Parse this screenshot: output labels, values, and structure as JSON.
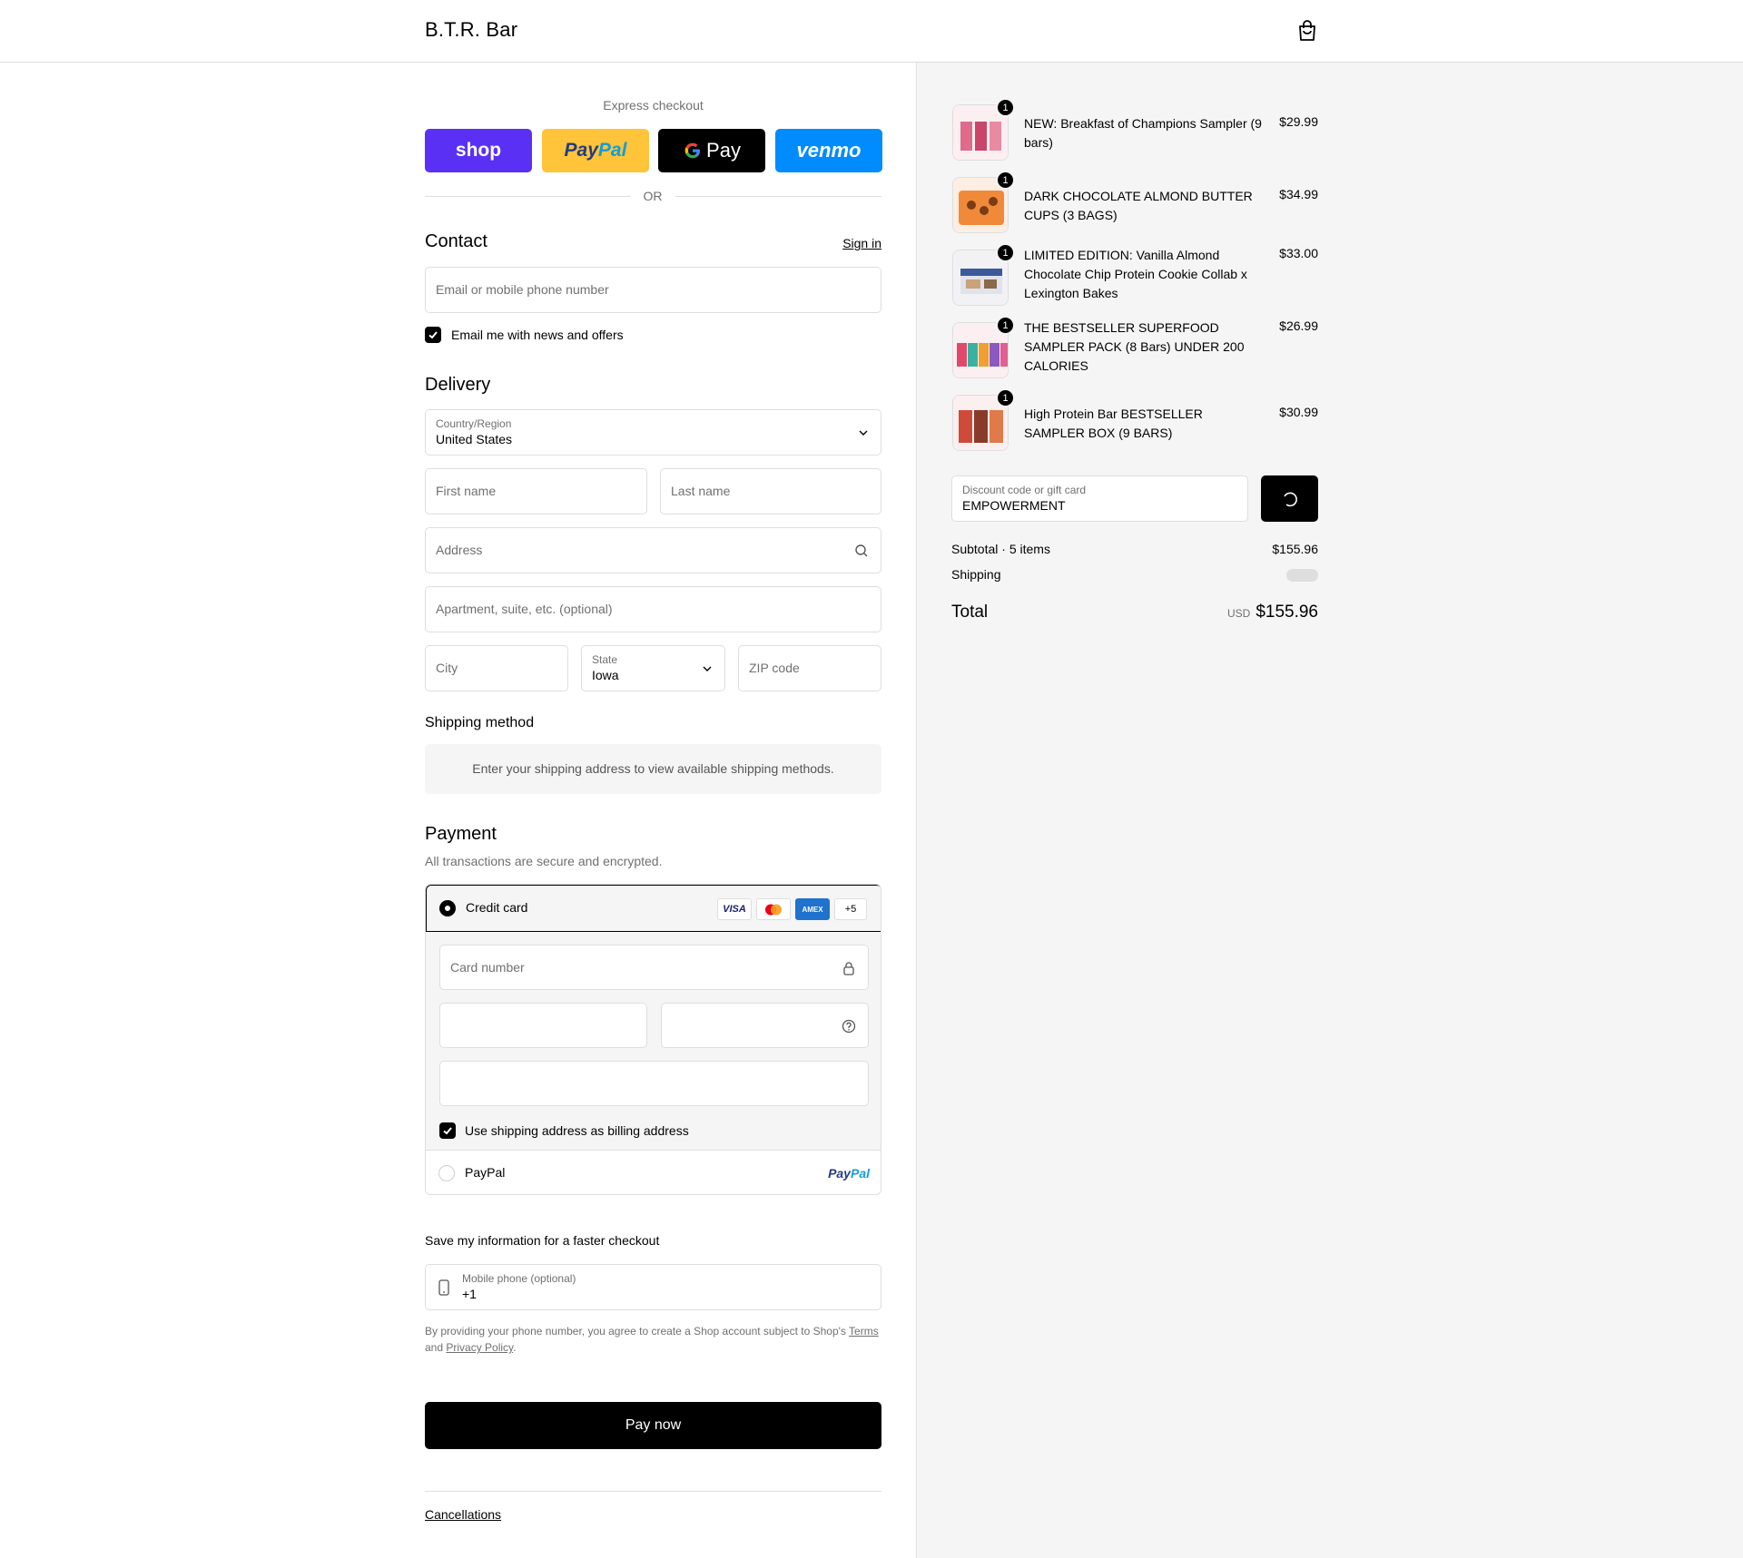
{
  "header": {
    "store_name": "B.T.R. Bar",
    "cart_icon": "shopping-bag-icon"
  },
  "express": {
    "title": "Express checkout",
    "shop_label": "shop",
    "paypal_label_1": "Pay",
    "paypal_label_2": "Pal",
    "gpay_label": "Pay",
    "venmo_label": "venmo",
    "or_label": "OR"
  },
  "contact": {
    "heading": "Contact",
    "sign_in": "Sign in",
    "email_placeholder": "Email or mobile phone number",
    "news_checkbox_label": "Email me with news and offers",
    "news_checked": true
  },
  "delivery": {
    "heading": "Delivery",
    "country_label": "Country/Region",
    "country_value": "United States",
    "first_name_placeholder": "First name",
    "last_name_placeholder": "Last name",
    "address_placeholder": "Address",
    "apartment_placeholder": "Apartment, suite, etc. (optional)",
    "city_placeholder": "City",
    "state_label": "State",
    "state_value": "Iowa",
    "zip_placeholder": "ZIP code"
  },
  "shipping_method": {
    "heading": "Shipping method",
    "notice": "Enter your shipping address to view available shipping methods."
  },
  "payment": {
    "heading": "Payment",
    "subtitle": "All transactions are secure and encrypted.",
    "credit_card_label": "Credit card",
    "card_badges": [
      "VISA",
      "MC",
      "AMEX",
      "+5"
    ],
    "card_number_placeholder": "Card number",
    "billing_checkbox_label": "Use shipping address as billing address",
    "billing_checked": true,
    "paypal_label": "PayPal",
    "paypal_logo_1": "Pay",
    "paypal_logo_2": "Pal"
  },
  "save_info": {
    "heading": "Save my information for a faster checkout",
    "phone_label": "Mobile phone (optional)",
    "phone_value": "+1",
    "legal_1": "By providing your phone number, you agree to create a Shop account subject to Shop's ",
    "terms_link": "Terms",
    "legal_2": "and ",
    "privacy_link": "Privacy Policy",
    "legal_3": "."
  },
  "pay_now_label": "Pay now",
  "footer": {
    "cancellations_link": "Cancellations"
  },
  "order": {
    "items": [
      {
        "qty": "1",
        "name": "NEW: Breakfast of Champions Sampler (9 bars)",
        "price": "$29.99"
      },
      {
        "qty": "1",
        "name": "DARK CHOCOLATE ALMOND BUTTER CUPS (3 BAGS)",
        "price": "$34.99"
      },
      {
        "qty": "1",
        "name": "LIMITED EDITION: Vanilla Almond Chocolate Chip Protein Cookie Collab x Lexington Bakes",
        "price": "$33.00"
      },
      {
        "qty": "1",
        "name": "THE BESTSELLER SUPERFOOD SAMPLER PACK (8 Bars) UNDER 200 CALORIES",
        "price": "$26.99"
      },
      {
        "qty": "1",
        "name": "High Protein Bar BESTSELLER SAMPLER BOX (9 BARS)",
        "price": "$30.99"
      }
    ],
    "discount_label": "Discount code or gift card",
    "discount_value": "EMPOWERMENT",
    "subtotal_label": "Subtotal · 5 items",
    "subtotal_value": "$155.96",
    "shipping_label": "Shipping",
    "total_label": "Total",
    "total_currency": "USD",
    "total_value": "$155.96"
  }
}
